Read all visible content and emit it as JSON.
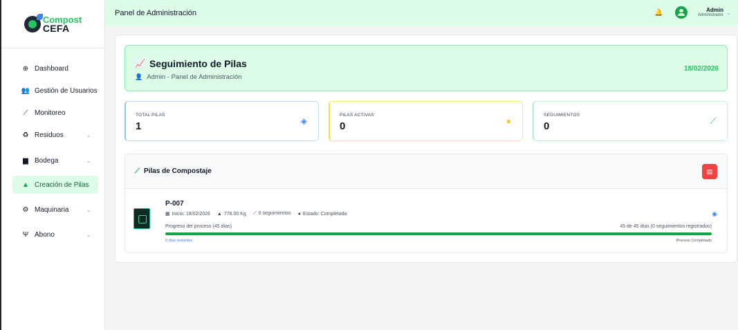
{
  "logo": {
    "top": "Compost",
    "bottom": "CEFA"
  },
  "sidebar": {
    "items": [
      {
        "label": "Dashboard",
        "icon": "globe-icon"
      },
      {
        "label": "Gestión de Usuarios",
        "icon": "users-icon"
      },
      {
        "label": "Monitoreo",
        "icon": "chart-line-icon"
      },
      {
        "label": "Residuos",
        "icon": "recycle-icon"
      },
      {
        "label": "Bodega",
        "icon": "warehouse-icon"
      },
      {
        "label": "Creación de Pilas",
        "icon": "triangle-icon"
      },
      {
        "label": "Maquinaria",
        "icon": "cogs-icon"
      },
      {
        "label": "Abono",
        "icon": "seedling-icon"
      }
    ]
  },
  "header": {
    "title": "Panel de Administración",
    "user_name": "Admin",
    "user_role": "Administrador"
  },
  "banner": {
    "title": "Seguimiento de Pilas",
    "subtitle": "Admin - Panel de Administración",
    "date": "18/02/2026"
  },
  "stats": [
    {
      "label": "TOTAL PILAS",
      "value": "1",
      "icon": "layers-icon",
      "color": "#3b82f6"
    },
    {
      "label": "PILAS ACTIVAS",
      "value": "0",
      "icon": "clock-icon",
      "color": "#facc15"
    },
    {
      "label": "SEGUIMIENTOS",
      "value": "0",
      "icon": "chart-line-icon",
      "color": "#22c55e"
    }
  ],
  "list": {
    "title": "Pilas de Compostaje",
    "pile": {
      "code": "P-007",
      "start": "Inicio: 18/02/2026",
      "weight": "778.00 Kg",
      "tracking": "0 seguimientos",
      "status": "Estado: Completada",
      "progress_label": "Progreso del proceso (45 días)",
      "progress_right": "45 de 45 días (0 seguimientos registrados)",
      "progress": 1.0,
      "remaining": "0 días restantes",
      "complete": "Proceso Completado"
    }
  },
  "colors": {
    "accent": "#16a34a",
    "header_bg": "#dcfce7"
  }
}
